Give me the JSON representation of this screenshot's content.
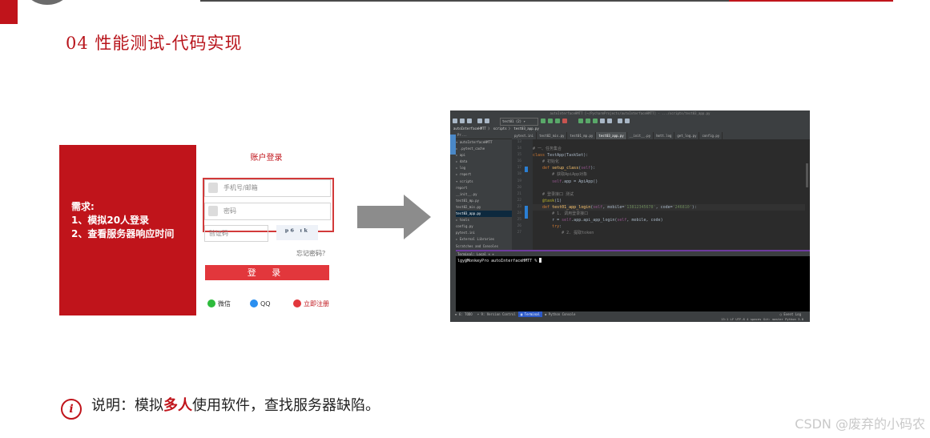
{
  "slide": {
    "title": "04 性能测试-代码实现",
    "note_before": "说明：模拟",
    "note_highlight": "多人",
    "note_after": "使用软件，查找服务器缺陷。",
    "note_icon": "info-icon",
    "watermark": "CSDN @废弃的小码农",
    "accent_color": "#c0141b"
  },
  "requirements": {
    "heading": "需求:",
    "items": [
      "1、模拟20人登录",
      "2、查看服务器响应时间"
    ]
  },
  "login_form": {
    "title": "账户登录",
    "phone_placeholder": "手机号/邮箱",
    "password_placeholder": "密码",
    "captcha_placeholder": "验证码",
    "captcha_text": "ᵖ⁶ ᶦᵏ",
    "forgot_link": "忘记密码？",
    "login_button": "登 录",
    "wechat": "微信",
    "qq": "QQ",
    "register": "立即注册"
  },
  "ide": {
    "window_title": "autoInterfaceHMTT [~/PycharmProjects/autoInterfaceHMTT] - .../scripts/test03_app.py",
    "run_config": "test01 (2) ▾",
    "breadcrumb": "autoInterfaceHMTT 〉 scripts 〉 test03_app.py",
    "project_header": "Pr...",
    "project_tree": [
      "▾ autoInterfaceHMTT",
      "  ▸ .pytest_cache",
      "  ▸ api",
      "  ▸ data",
      "  ▸ log",
      "  ▸ report",
      "  ▾ scripts",
      "      report",
      "      __init__.py",
      "      test01_mp.py",
      "      test02_mis.py",
      "      test03_app.py",
      "  ▸ tools",
      "    config.py",
      "    pytest.ini",
      "▸ External Libraries",
      "  Scratches and Consoles"
    ],
    "selected_file_index": 11,
    "tabs": [
      "pytest.ini",
      "test02_mis.py",
      "test01_mp.py",
      "test03_app.py",
      "__init__.py",
      "hmtt.log",
      "get_log.py",
      "config.py"
    ],
    "active_tab_index": 3,
    "line_numbers": [
      "13",
      "14",
      "15",
      "16",
      "17",
      "18",
      "19",
      "20",
      "21",
      "22",
      "23",
      "24",
      "25",
      "26",
      "27"
    ],
    "code_lines": [
      [],
      [
        {
          "c": "cm",
          "t": "# 一、任务集合"
        }
      ],
      [
        {
          "c": "kw",
          "t": "class "
        },
        {
          "c": "",
          "t": "TestApp(TaskSet):"
        }
      ],
      [
        {
          "c": "cm",
          "t": "    # 初始化"
        }
      ],
      [
        {
          "c": "kw",
          "t": "    def "
        },
        {
          "c": "fn",
          "t": "setup_class"
        },
        {
          "c": "",
          "t": "("
        },
        {
          "c": "sf",
          "t": "self"
        },
        {
          "c": "",
          "t": "):"
        }
      ],
      [
        {
          "c": "cm",
          "t": "        # 获取ApiApp对象"
        }
      ],
      [
        {
          "c": "sf",
          "t": "        self"
        },
        {
          "c": "",
          "t": ".app = ApiApp()"
        }
      ],
      [],
      [
        {
          "c": "cm",
          "t": "    # 登录接口 测试"
        }
      ],
      [
        {
          "c": "dc",
          "t": "    @task"
        },
        {
          "c": "",
          "t": "(1)"
        }
      ],
      [
        {
          "c": "kw",
          "t": "    def "
        },
        {
          "c": "fn",
          "t": "test01_app_login"
        },
        {
          "c": "",
          "t": "("
        },
        {
          "c": "sf",
          "t": "self"
        },
        {
          "c": "",
          "t": ", mobile="
        },
        {
          "c": "st",
          "t": "'13812345678'"
        },
        {
          "c": "",
          "t": ", code="
        },
        {
          "c": "st",
          "t": "'246810'"
        },
        {
          "c": "",
          "t": "):"
        }
      ],
      [
        {
          "c": "cm",
          "t": "        # 1. 调用登录接口"
        }
      ],
      [
        {
          "c": "",
          "t": "        r = "
        },
        {
          "c": "sf",
          "t": "self"
        },
        {
          "c": "",
          "t": ".app.api_app_login("
        },
        {
          "c": "sf",
          "t": "self"
        },
        {
          "c": "",
          "t": ", mobile, code)"
        }
      ],
      [
        {
          "c": "kw",
          "t": "        try"
        },
        {
          "c": "",
          "t": ":"
        }
      ],
      [
        {
          "c": "cm",
          "t": "            # 2. 提取token"
        }
      ]
    ],
    "terminal_header": "Terminal:   Local ×   +",
    "terminal_line": "lgy@MonkeyPro autoInterfaceHMTT % ",
    "bottom_tabs": [
      "≡ 6: TODO",
      "⑂ 9: Version Control",
      "▣ Terminal",
      "◆ Python Console"
    ],
    "active_bottom_tab_index": 2,
    "event_log": "◯ Event Log",
    "status_right": "13:1   LF   UTF-8   4 spaces   Git: master   Python 3.8"
  }
}
